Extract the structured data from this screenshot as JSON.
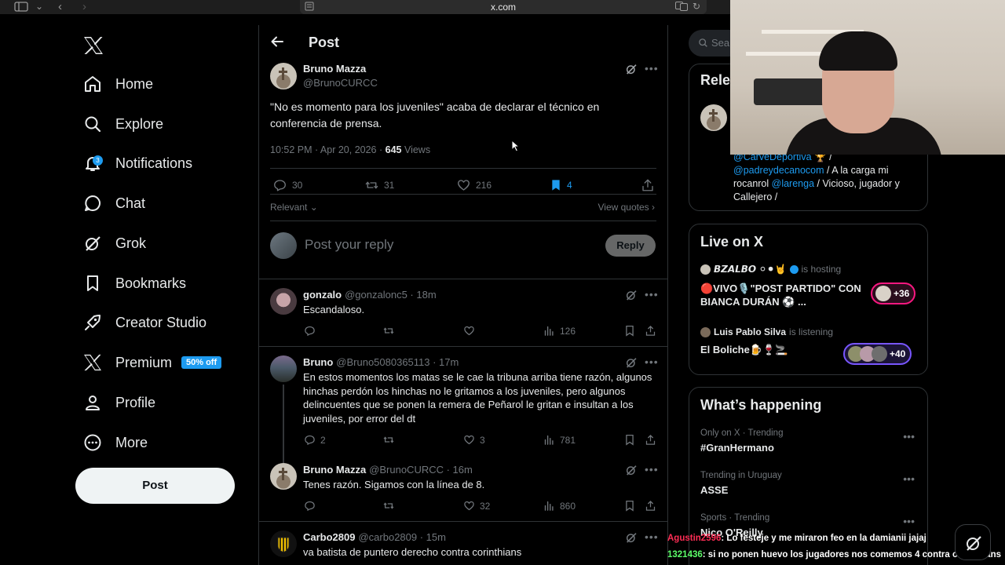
{
  "browser": {
    "url": "x.com"
  },
  "nav": {
    "items": [
      {
        "label": "Home"
      },
      {
        "label": "Explore"
      },
      {
        "label": "Notifications",
        "badge": "3"
      },
      {
        "label": "Chat"
      },
      {
        "label": "Grok"
      },
      {
        "label": "Bookmarks"
      },
      {
        "label": "Creator Studio"
      },
      {
        "label": "Premium",
        "badge": "50% off"
      },
      {
        "label": "Profile"
      },
      {
        "label": "More"
      }
    ],
    "post_button": "Post"
  },
  "header": {
    "title": "Post"
  },
  "main_post": {
    "name": "Bruno Mazza",
    "handle": "@BrunoCURCC",
    "text": "\"No es momento para los juveniles\" acaba de declarar el técnico en conferencia de prensa.",
    "time": "10:52 PM · Apr 20, 2026 · ",
    "views": "645",
    "views_label": " Views",
    "replies": "30",
    "reposts": "31",
    "likes": "216",
    "bookmarks": "4"
  },
  "sort": {
    "relevant": "Relevant",
    "view_quotes": "View quotes"
  },
  "reply_box": {
    "placeholder": "Post your reply",
    "button": "Reply"
  },
  "replies": [
    {
      "name": "gonzalo",
      "handle": "@gonzalonc5 · 18m",
      "text": "Escandaloso.",
      "replies": "",
      "reposts": "",
      "likes": "",
      "views": "126"
    },
    {
      "name": "Bruno",
      "handle": "@Bruno5080365113 · 17m",
      "text": "En estos momentos los matas se le cae la tribuna arriba tiene razón, algunos hinchas perdón los hinchas no le gritamos a los juveniles, pero algunos delincuentes que se ponen la remera de Peñarol le gritan e insultan a los juveniles, por error del dt",
      "replies": "2",
      "reposts": "",
      "likes": "3",
      "views": "781"
    },
    {
      "name": "Bruno Mazza",
      "handle": "@BrunoCURCC · 16m",
      "text": "Tenes razón. Sigamos con la línea de 8.",
      "replies": "",
      "reposts": "",
      "likes": "32",
      "views": "860"
    },
    {
      "name": "Carbo2809",
      "handle": "@carbo2809 · 15m",
      "text": "va batista de puntero derecho contra corinthians"
    }
  ],
  "right": {
    "search_placeholder": "Sear",
    "relevant_title": "Rele",
    "bio_links": [
      "@CarveDeportiva",
      "@padreydecanocom",
      "@larenga"
    ],
    "bio_tail1": " / A la carga mi rocanrol ",
    "bio_tail2": " / Vicioso, jugador y Callejero /",
    "live": {
      "title": "Live on X",
      "host1": "𝘽𝙕𝘼𝙇𝘽𝙊 ⚪⚫🤘",
      "host1_status": "is hosting",
      "space1": "🔴VIVO🎙️\"POST PARTIDO\" CON BIANCA DURÁN ⚽ ...",
      "space1_count": "+36",
      "host2": "Luis Pablo Silva",
      "host2_status": "is listening",
      "space2": "El Boliche🍺🍷🚬",
      "space2_count": "+40"
    },
    "happening": {
      "title": "What’s happening",
      "trends": [
        {
          "category": "Only on X · Trending",
          "name": "#GranHermano"
        },
        {
          "category": "Trending in Uruguay",
          "name": "ASSE"
        },
        {
          "category": "Sports · Trending",
          "name": "Nico O'Reilly"
        }
      ]
    }
  },
  "stream_chat": [
    {
      "user": "Agustin2596",
      "text": ": Lo festeje y me miraron feo en la damianii jajaj"
    },
    {
      "user": "1321436",
      "text": ": si no ponen huevo los jugadores nos comemos 4 contra corinthians"
    }
  ],
  "colors": {
    "accent": "#1d9bf0",
    "background": "#000000",
    "border": "#2f3336",
    "muted": "#71767b"
  }
}
